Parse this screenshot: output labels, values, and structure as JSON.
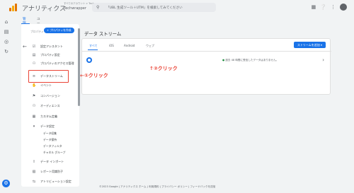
{
  "header": {
    "app_title": "アナリティクス",
    "breadcrumb": "すべてのアカウント > Techwrapper",
    "account_name": "Techwrapper",
    "search_placeholder": "「UBL 生成ツール＋UTM」を検索してみてください"
  },
  "tabs": {
    "admin": "管理",
    "user": "ユーザー"
  },
  "left_panel": {
    "property_label": "プロパティ",
    "create_property_button": "+ プロパティを作成",
    "items": [
      {
        "icon": "setup-assistant-icon",
        "label": "設定アシスタント"
      },
      {
        "icon": "property-settings-icon",
        "label": "プロパティ設定"
      },
      {
        "icon": "property-access-icon",
        "label": "プロパティのアクセス管理"
      },
      {
        "icon": "data-stream-icon",
        "label": "データストリーム"
      },
      {
        "icon": "events-icon",
        "label": "イベント"
      },
      {
        "icon": "conversions-icon",
        "label": "コンバージョン"
      },
      {
        "icon": "audiences-icon",
        "label": "オーディエンス"
      },
      {
        "icon": "custom-definitions-icon",
        "label": "カスタム定義"
      },
      {
        "icon": "data-settings-icon",
        "label": "データ設定"
      }
    ],
    "data_settings_sub": [
      "データ収集",
      "データ保持",
      "データフィルタ",
      "チャネル グループ"
    ],
    "items_bottom": [
      {
        "icon": "data-import-icon",
        "label": "データ インポート"
      },
      {
        "icon": "reporting-id-icon",
        "label": "レポート用識別子"
      },
      {
        "icon": "attribution-settings-icon",
        "label": "アトリビューション設定"
      }
    ]
  },
  "main": {
    "title": "データ ストリーム",
    "stream_tabs": [
      "すべて",
      "iOS",
      "Android",
      "ウェブ"
    ],
    "add_stream_button": "ストリームを追加",
    "stream_status": "過去 48 時間に受信したデータはありません。"
  },
  "annotations": {
    "click1": "←①クリック",
    "click2": "↑②クリック"
  },
  "footer": {
    "text": "©2023 Google | アナリティクス ホーム | 利用規約 | プライバシー ポリシー | フィードバックを送信"
  },
  "colors": {
    "accent": "#1a73e8",
    "annotation": "#ea4335",
    "background": "#f1f3f4"
  }
}
